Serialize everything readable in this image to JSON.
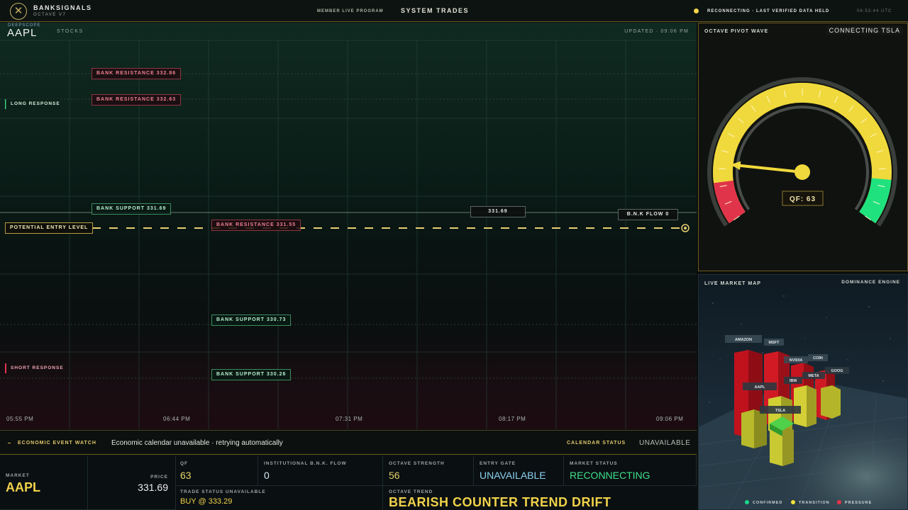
{
  "topbar": {
    "logo_glyph": "✕",
    "brand": "BANKSIGNALS",
    "brand_sub": "OCTAVE V7",
    "program": "MEMBER LIVE PROGRAM",
    "section": "SYSTEM TRADES",
    "connection_status": "RECONNECTING · LAST VERIFIED DATA HELD",
    "utc_time": "06:53:44 UTC",
    "status_color": "#f2d44a"
  },
  "chart": {
    "sublabel": "DEEPSCOPE",
    "symbol": "AAPL",
    "category": "STOCKS",
    "updated": "UPDATED · 09:06 PM",
    "long_response": "LONG RESPONSE",
    "short_response": "SHORT RESPONSE",
    "entry_label": "POTENTIAL ENTRY LEVEL",
    "last_price": "331.69",
    "flow_tag": "B.N.K FLOW 0",
    "levels": {
      "res1": "BANK RESISTANCE 332.86",
      "res2": "BANK RESISTANCE 332.63",
      "res3": "BANK RESISTANCE 331.55",
      "sup1": "BANK SUPPORT 331.69",
      "sup2": "BANK SUPPORT 330.73",
      "sup3": "BANK SUPPORT 330.26"
    },
    "x_ticks": [
      "05:55 PM",
      "06:44 PM",
      "07:31 PM",
      "08:17 PM",
      "09:06 PM"
    ]
  },
  "events": {
    "label": "ECONOMIC EVENT WATCH",
    "message": "Economic calendar unavailable · retrying automatically",
    "calendar_label": "CALENDAR STATUS",
    "calendar_value": "UNAVAILABLE"
  },
  "stats": {
    "market_label": "MARKET",
    "market_value": "AAPL",
    "price_label": "PRICE",
    "price_value": "331.69",
    "qf_label": "QF",
    "qf_value": "63",
    "flow_label": "INSTITUTIONAL B.N.K. FLOW",
    "flow_value": "0",
    "strength_label": "OCTAVE STRENGTH",
    "strength_value": "56",
    "gate_label": "ENTRY GATE",
    "gate_value": "UNAVAILABLE",
    "mstatus_label": "MARKET STATUS",
    "mstatus_value": "RECONNECTING",
    "trade_label": "TRADE STATUS UNAVAILABLE",
    "trade_value": "BUY @ 333.29",
    "trend_label": "OCTAVE TREND",
    "trend_value": "BEARISH COUNTER TREND DRIFT"
  },
  "gauge": {
    "title": "OCTAVE PIVOT WAVE",
    "connecting": "CONNECTING TSLA",
    "qf_display": "QF: 63",
    "qf_value": 63
  },
  "market_map": {
    "title": "LIVE MARKET MAP",
    "engine": "DOMINANCE ENGINE",
    "labels": [
      "AMAZON",
      "MSFT",
      "NVIDIA",
      "COIN",
      "AAPL",
      "IBM",
      "META",
      "GOOG",
      "TSLA"
    ],
    "legend": [
      {
        "label": "CONFIRMED",
        "color": "#19d78a"
      },
      {
        "label": "TRANSITION",
        "color": "#f2e23a"
      },
      {
        "label": "PRESSURE",
        "color": "#e8324a"
      }
    ]
  }
}
